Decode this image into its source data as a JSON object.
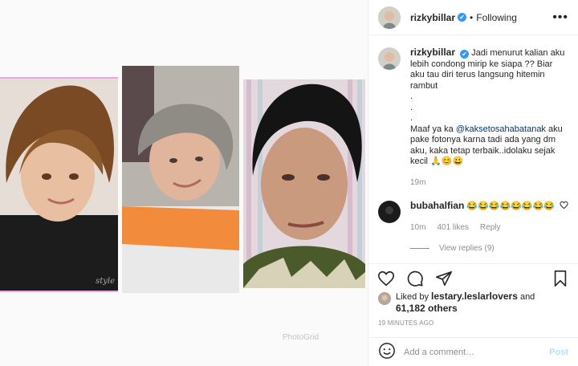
{
  "media": {
    "watermark": "PhotoGrid",
    "photo_caption": "style"
  },
  "post": {
    "author": "rizkybillar",
    "verified_mark": "✔",
    "separator": "•",
    "follow_state": "Following",
    "more_icon": "more-options-icon"
  },
  "caption": {
    "author": "rizkybillar",
    "text_part1": "Jadi menurut kalian aku lebih condong mirip ke siapa ?? Biar aku tau diri terus langsung hitemin rambut\n.\n.\n.\nMaaf ya ka ",
    "mention": "@kaksetosahabatanak",
    "text_part2": " aku pake fotonya karna tadi ada yang dm aku, kaka tetap terbaik..idolaku sejak kecil 🙏😊😀",
    "time": "19m"
  },
  "comment": {
    "author": "bubahalfian",
    "text": "😂😂😂😂😂😂😂😂",
    "time": "10m",
    "likes": "401 likes",
    "reply": "Reply"
  },
  "view_replies": "View replies (9)",
  "likes": {
    "prefix": "Liked by ",
    "user": "lestary.leslarlovers",
    "mid": " and",
    "count": "61,182 others"
  },
  "timestamp": "19 MINUTES AGO",
  "add_comment": {
    "placeholder": "Add a comment…",
    "post": "Post"
  }
}
